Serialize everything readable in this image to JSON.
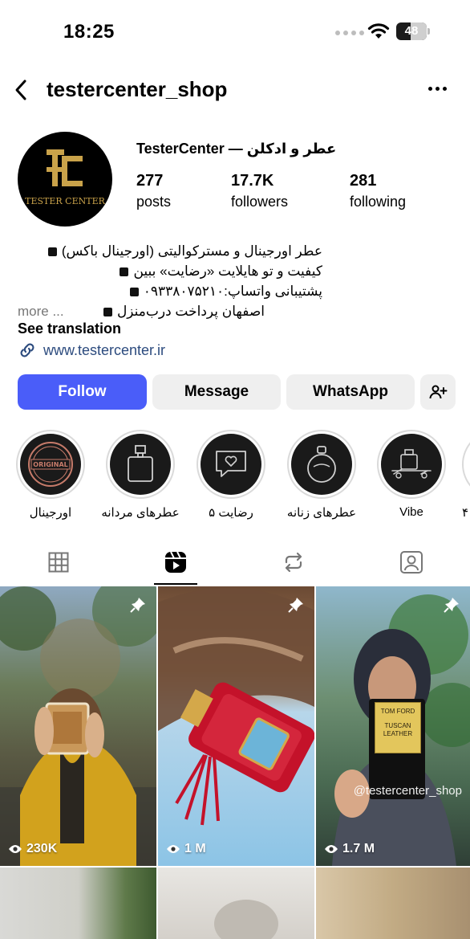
{
  "status_bar": {
    "time": "18:25",
    "battery": "48",
    "battery_fraction": 0.48
  },
  "header": {
    "username": "testercenter_shop"
  },
  "profile": {
    "display_name": "TesterCenter — عطر و ادکلن",
    "avatar_text": "TESTER CENTER",
    "stats": [
      {
        "value": "277",
        "label": "posts"
      },
      {
        "value": "17.7K",
        "label": "followers"
      },
      {
        "value": "281",
        "label": "following"
      }
    ],
    "bio": [
      "عطر اورجینال و مسترکوالیتی (اورجینال باکس)",
      "کیفیت و تو هایلایت «رضایت» ببین",
      "پشتیبانی واتساپ:۰۹۳۳۸۰۷۵۲۱۰"
    ],
    "bio_last": "اصفهان پرداخت درب‌منزل",
    "bio_more": "more ...",
    "see_translation": "See translation",
    "link": "www.testercenter.ir"
  },
  "actions": {
    "follow": "Follow",
    "message": "Message",
    "whatsapp": "WhatsApp"
  },
  "highlights": [
    {
      "label": "اورجینال",
      "icon": "original-stamp-icon",
      "badge": "ORIGINAL"
    },
    {
      "label": "عطرهای مردانه",
      "icon": "perfume-bottle-icon"
    },
    {
      "label": "رضایت ۵",
      "icon": "heart-chat-icon"
    },
    {
      "label": "عطرهای زنانه",
      "icon": "round-perfume-icon"
    },
    {
      "label": "Vibe",
      "icon": "perfume-set-icon"
    },
    {
      "label": "۴"
    }
  ],
  "tabs": [
    {
      "name": "posts",
      "icon": "grid-icon"
    },
    {
      "name": "reels",
      "icon": "reels-icon",
      "active": true
    },
    {
      "name": "reposts",
      "icon": "repost-icon"
    },
    {
      "name": "tagged",
      "icon": "tagged-icon"
    }
  ],
  "posts": [
    {
      "views": "230K",
      "pinned": true
    },
    {
      "views": "1 M",
      "pinned": true
    },
    {
      "views": "1.7 M",
      "pinned": true,
      "watermark": "@testercenter_shop",
      "label_brand": "TOM FORD",
      "label_name": "TUSCAN LEATHER"
    }
  ],
  "colors": {
    "follow": "#4a5df9",
    "link": "#2c4b7e",
    "button_bg": "#efefef"
  }
}
